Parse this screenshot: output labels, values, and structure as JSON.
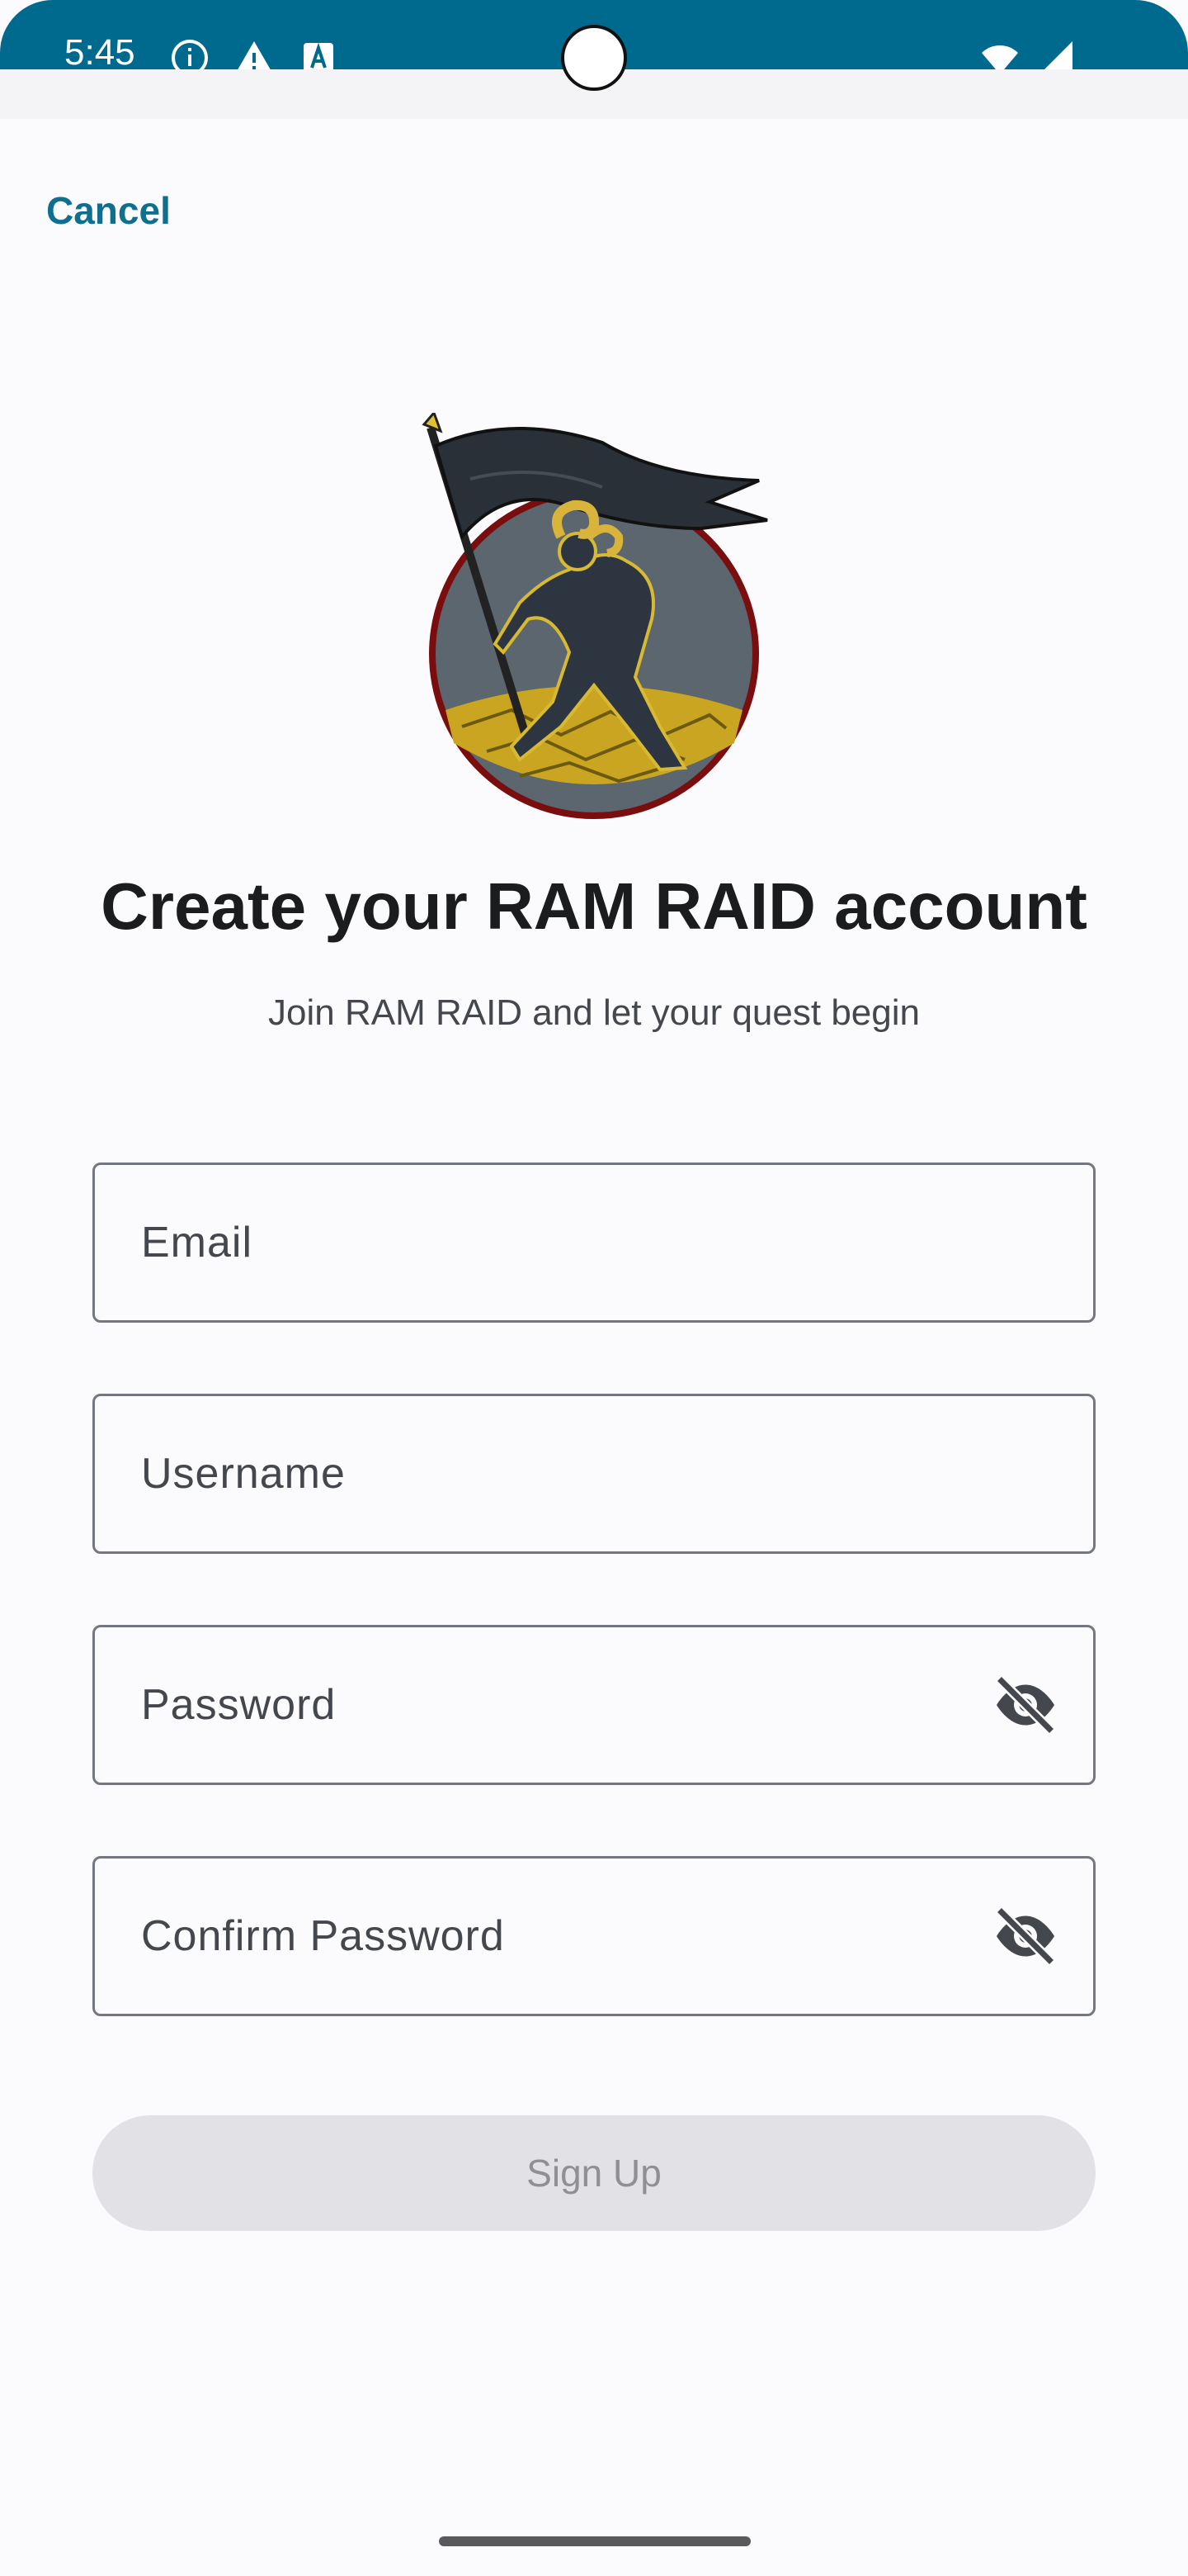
{
  "status_bar": {
    "time": "5:45",
    "icons": [
      "info-icon",
      "alert-icon",
      "a-badge-icon",
      "wifi-icon",
      "signal-icon"
    ],
    "background": "#006a8e"
  },
  "header": {
    "cancel_label": "Cancel"
  },
  "logo": {
    "icon": "ram-flag-logo"
  },
  "main": {
    "title": "Create your RAM RAID account",
    "subtitle": "Join RAM RAID and let your quest begin"
  },
  "form": {
    "email_label": "Email",
    "username_label": "Username",
    "password_label": "Password",
    "confirm_password_label": "Confirm Password",
    "visibility_icon": "eye-off-icon",
    "submit_label": "Sign Up",
    "submit_enabled": false
  },
  "colors": {
    "accent": "#0e6f8f",
    "background": "#fbfbfd",
    "field_border": "#74777f",
    "button_disabled": "#e2e2e6"
  }
}
